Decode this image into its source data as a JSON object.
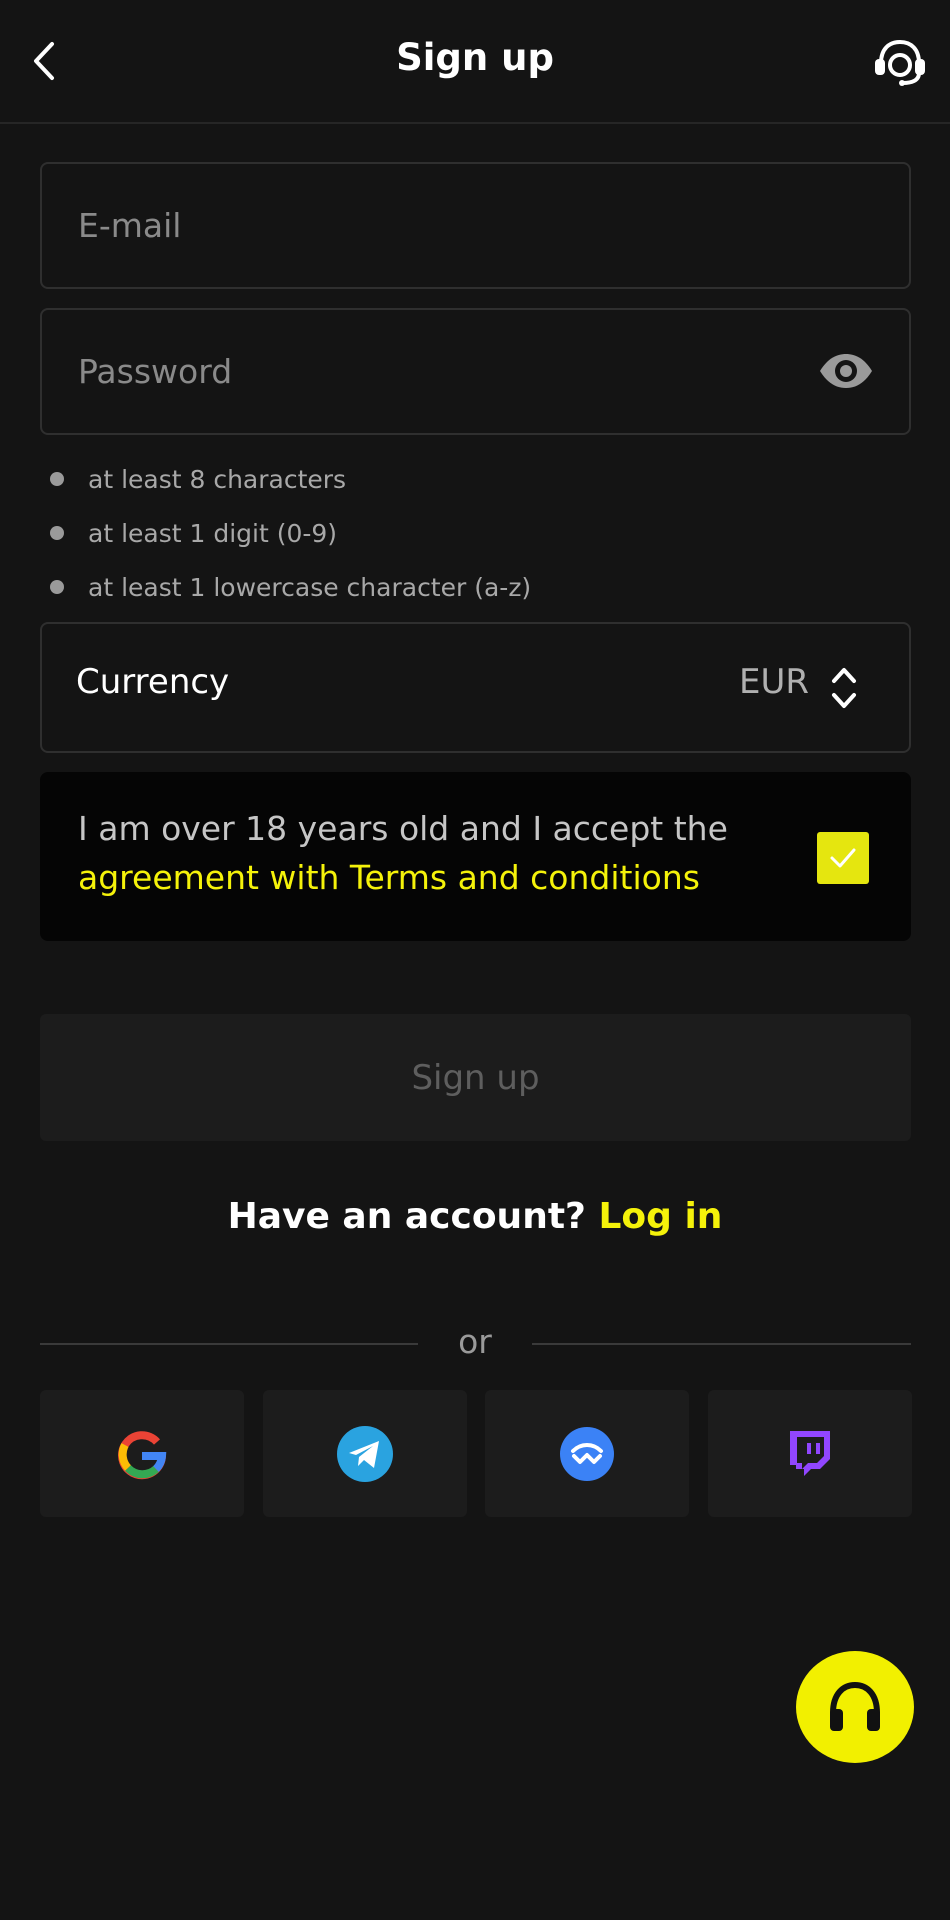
{
  "header": {
    "title": "Sign up",
    "back_icon": "chevron-left-icon",
    "support_icon": "support-agent-icon"
  },
  "form": {
    "email_placeholder": "E-mail",
    "email_value": "",
    "password_placeholder": "Password",
    "password_value": "",
    "password_toggle_icon": "eye-icon",
    "password_rules": [
      "at least 8 characters",
      "at least 1 digit (0-9)",
      "at least 1 lowercase character (a-z)"
    ],
    "currency_label": "Currency",
    "currency_value": "EUR",
    "terms_text": "I am over 18 years old and I accept the",
    "terms_link": "agreement with Terms and conditions",
    "terms_checked": true,
    "submit_label": "Sign up"
  },
  "login_prompt": {
    "text": "Have an account?",
    "link": "Log in"
  },
  "divider": {
    "text": "or"
  },
  "social": [
    {
      "name": "google",
      "icon": "google-icon"
    },
    {
      "name": "telegram",
      "icon": "telegram-icon"
    },
    {
      "name": "walletconnect",
      "icon": "walletconnect-icon"
    },
    {
      "name": "twitch",
      "icon": "twitch-icon"
    }
  ],
  "fab": {
    "icon": "headphones-icon"
  },
  "colors": {
    "background": "#141414",
    "accent": "#f5f20a",
    "field_border": "#2f2f2f",
    "button_disabled_bg": "#1c1c1c"
  }
}
